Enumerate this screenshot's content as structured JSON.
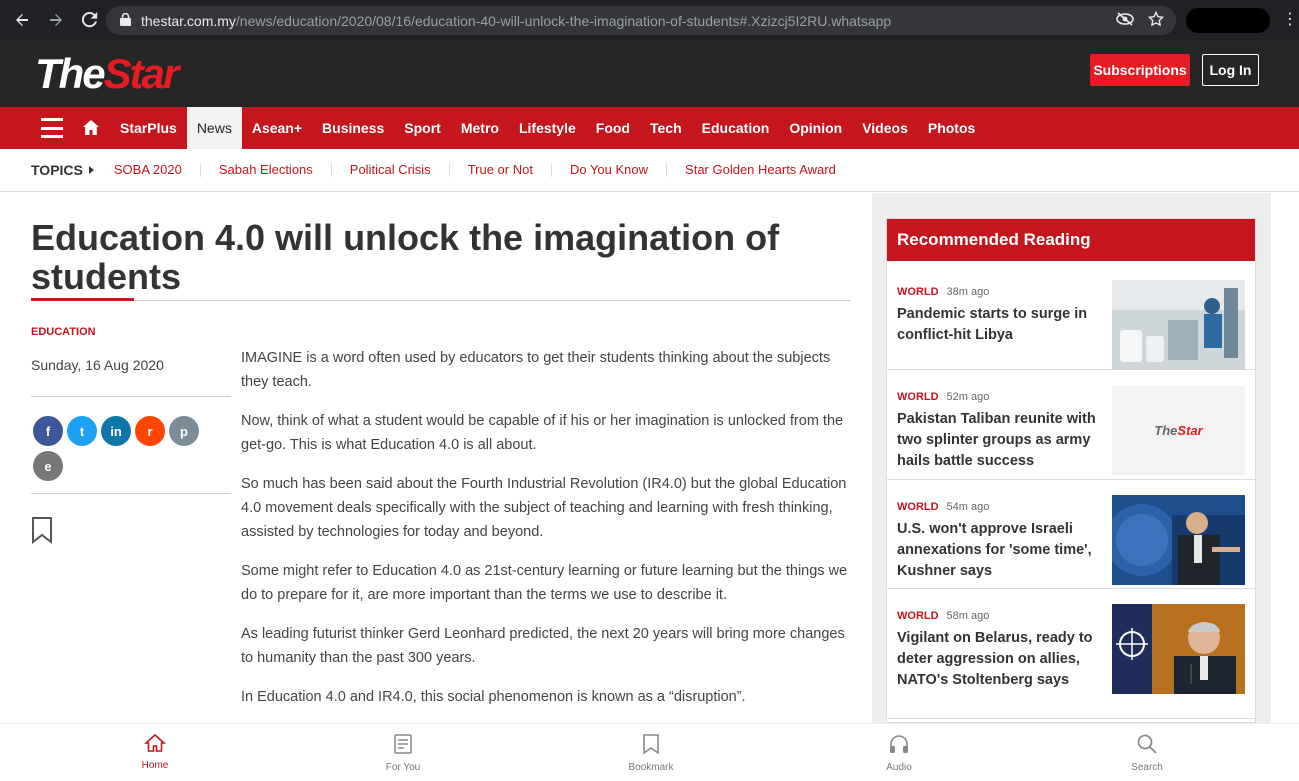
{
  "browser": {
    "url_host": "thestar.com.my",
    "url_path": "/news/education/2020/08/16/education-40-will-unlock-the-imagination-of-students#.Xzizcj5I2RU.whatsapp"
  },
  "masthead": {
    "logo_the": "The",
    "logo_star": "Star",
    "subscriptions_label": "Subscriptions",
    "login_label": "Log In"
  },
  "nav": {
    "items": [
      {
        "label": "StarPlus"
      },
      {
        "label": "News"
      },
      {
        "label": "Asean+"
      },
      {
        "label": "Business"
      },
      {
        "label": "Sport"
      },
      {
        "label": "Metro"
      },
      {
        "label": "Lifestyle"
      },
      {
        "label": "Food"
      },
      {
        "label": "Tech"
      },
      {
        "label": "Education"
      },
      {
        "label": "Opinion"
      },
      {
        "label": "Videos"
      },
      {
        "label": "Photos"
      }
    ],
    "active_index": 1
  },
  "topics": {
    "label": "TOPICS",
    "items": [
      {
        "label": "SOBA 2020"
      },
      {
        "label": "Sabah Elections"
      },
      {
        "label": "Political Crisis"
      },
      {
        "label": "True or Not"
      },
      {
        "label": "Do You Know"
      },
      {
        "label": "Star Golden Hearts Award"
      }
    ]
  },
  "article": {
    "headline": "Education 4.0 will unlock the imagination of students",
    "kicker": "EDUCATION",
    "date": "Sunday, 16 Aug 2020",
    "paragraphs": [
      "IMAGINE is a word often used by educators to get their students thinking about the subjects they teach.",
      "Now, think of what a student would be capable of if his or her imagination is unlocked from the get-go. This is what Education 4.0 is all about.",
      "So much has been said about the Fourth Industrial Revolution (IR4.0) but the global Education 4.0 movement deals specifically with the subject of teaching and learning with fresh thinking, assisted by technologies for today and beyond.",
      "Some might refer to Education 4.0 as 21st-century learning or future learning but the things we do to prepare for it, are more important than the terms we use to describe it.",
      "As leading futurist thinker Gerd Leonhard predicted, the next 20 years will bring more changes to humanity than the past 300 years.",
      "In Education 4.0 and IR4.0, this social phenomenon is known as a “disruption”."
    ],
    "share": {
      "facebook": "f",
      "twitter": "t",
      "linkedin": "in",
      "reddit": "r",
      "print": "p",
      "email": "e"
    }
  },
  "recommended": {
    "heading": "Recommended Reading",
    "items": [
      {
        "category": "WORLD",
        "time": "38m ago",
        "title": "Pandemic starts to surge in conflict-hit Libya"
      },
      {
        "category": "WORLD",
        "time": "52m ago",
        "title": "Pakistan Taliban reunite with two splinter groups as army hails battle success",
        "thumb_logo_the": "The",
        "thumb_logo_star": "Star"
      },
      {
        "category": "WORLD",
        "time": "54m ago",
        "title": "U.S. won't approve Israeli annexations for 'some time', Kushner says"
      },
      {
        "category": "WORLD",
        "time": "58m ago",
        "title": "Vigilant on Belarus, ready to deter aggression on allies, NATO's Stoltenberg says"
      }
    ]
  },
  "bottom_bar": {
    "items": [
      {
        "label": "Home"
      },
      {
        "label": "For You"
      },
      {
        "label": "Bookmark"
      },
      {
        "label": "Audio"
      },
      {
        "label": "Search"
      }
    ]
  },
  "colors": {
    "brand_red": "#c4161c",
    "masthead_bg": "#262626",
    "chrome_bg": "#202124"
  }
}
